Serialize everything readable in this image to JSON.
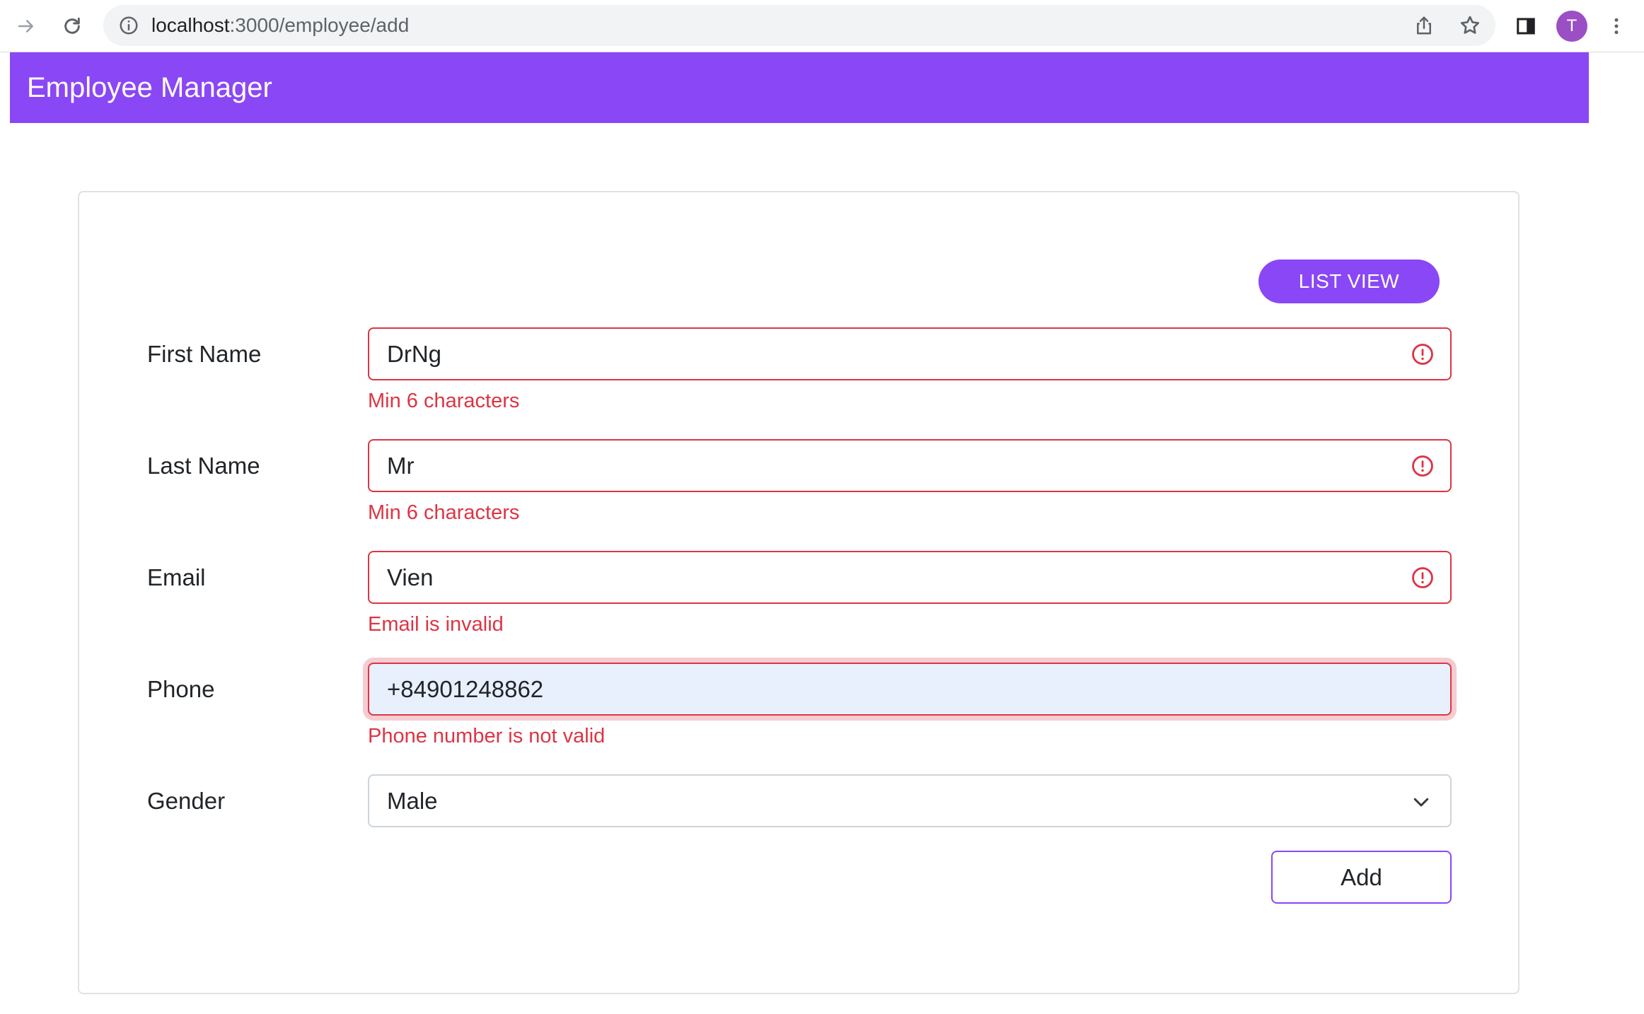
{
  "browser": {
    "url_host": "localhost",
    "url_path": ":3000/employee/add",
    "profile_initial": "T"
  },
  "app": {
    "title": "Employee Manager"
  },
  "form": {
    "list_view_label": "LIST VIEW",
    "first_name": {
      "label": "First Name",
      "value": "DrNg",
      "error": "Min 6 characters"
    },
    "last_name": {
      "label": "Last Name",
      "value": "Mr",
      "error": "Min 6 characters"
    },
    "email": {
      "label": "Email",
      "value": "Vien",
      "error": "Email is invalid"
    },
    "phone": {
      "label": "Phone",
      "value": "+84901248862",
      "error": "Phone number is not valid"
    },
    "gender": {
      "label": "Gender",
      "value": "Male"
    },
    "add_label": "Add"
  },
  "colors": {
    "brand": "#8a47f5",
    "error": "#dc3545",
    "autofill_bg": "#e8f0fe"
  },
  "icons": {
    "back": "arrow-right-icon",
    "reload": "reload-icon",
    "site_info": "info-icon",
    "share": "share-icon",
    "bookmark": "star-icon",
    "sidepanel": "side-panel-icon",
    "menu": "kebab-menu-icon",
    "field_error": "error-circle-icon",
    "select": "chevron-down-icon"
  }
}
